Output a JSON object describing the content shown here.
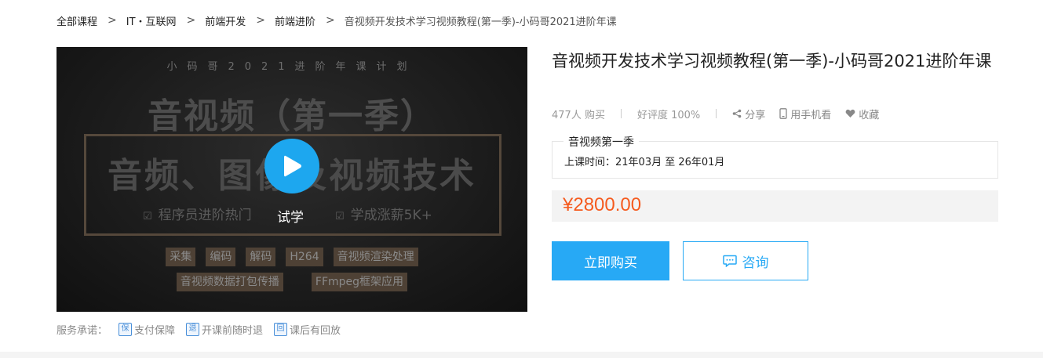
{
  "breadcrumb": {
    "items": [
      "全部课程",
      "IT・互联网",
      "前端开发",
      "前端进阶"
    ],
    "current": "音视频开发技术学习视频教程(第一季)-小码哥2021进阶年课",
    "separator": ">"
  },
  "cover": {
    "plan": "小码哥2021进阶年课计划",
    "season": "音视频（第一季）",
    "headline": "音频、图像及视频技术",
    "points": [
      "程序员进阶热门",
      "学成涨薪5K+"
    ],
    "tags_row1": [
      "采集",
      "编码",
      "解码",
      "H264",
      "音视频渲染处理"
    ],
    "tags_row2": [
      "音视频数据打包传播",
      "FFmpeg框架应用"
    ],
    "trial_label": "试学",
    "play_icon": "play-icon"
  },
  "service": {
    "label": "服务承诺：",
    "items": [
      {
        "icon_char": "保",
        "text": "支付保障"
      },
      {
        "icon_char": "退",
        "text": "开课前随时退"
      },
      {
        "icon_char": "回",
        "text": "课后有回放"
      }
    ]
  },
  "course": {
    "title": "音视频开发技术学习视频教程(第一季)-小码哥2021进阶年课",
    "buyers": "477人 购买",
    "rating": "好评度 100%",
    "share": "分享",
    "mobile": "用手机看",
    "favorite": "收藏"
  },
  "season_box": {
    "legend": "音视频第一季",
    "time": "上课时间：21年03月 至 26年01月"
  },
  "price": "¥2800.00",
  "buttons": {
    "buy": "立即购买",
    "consult": "咨询"
  },
  "colors": {
    "accent": "#27a9f5",
    "price": "#f55b1f",
    "play": "#1da7ef"
  }
}
